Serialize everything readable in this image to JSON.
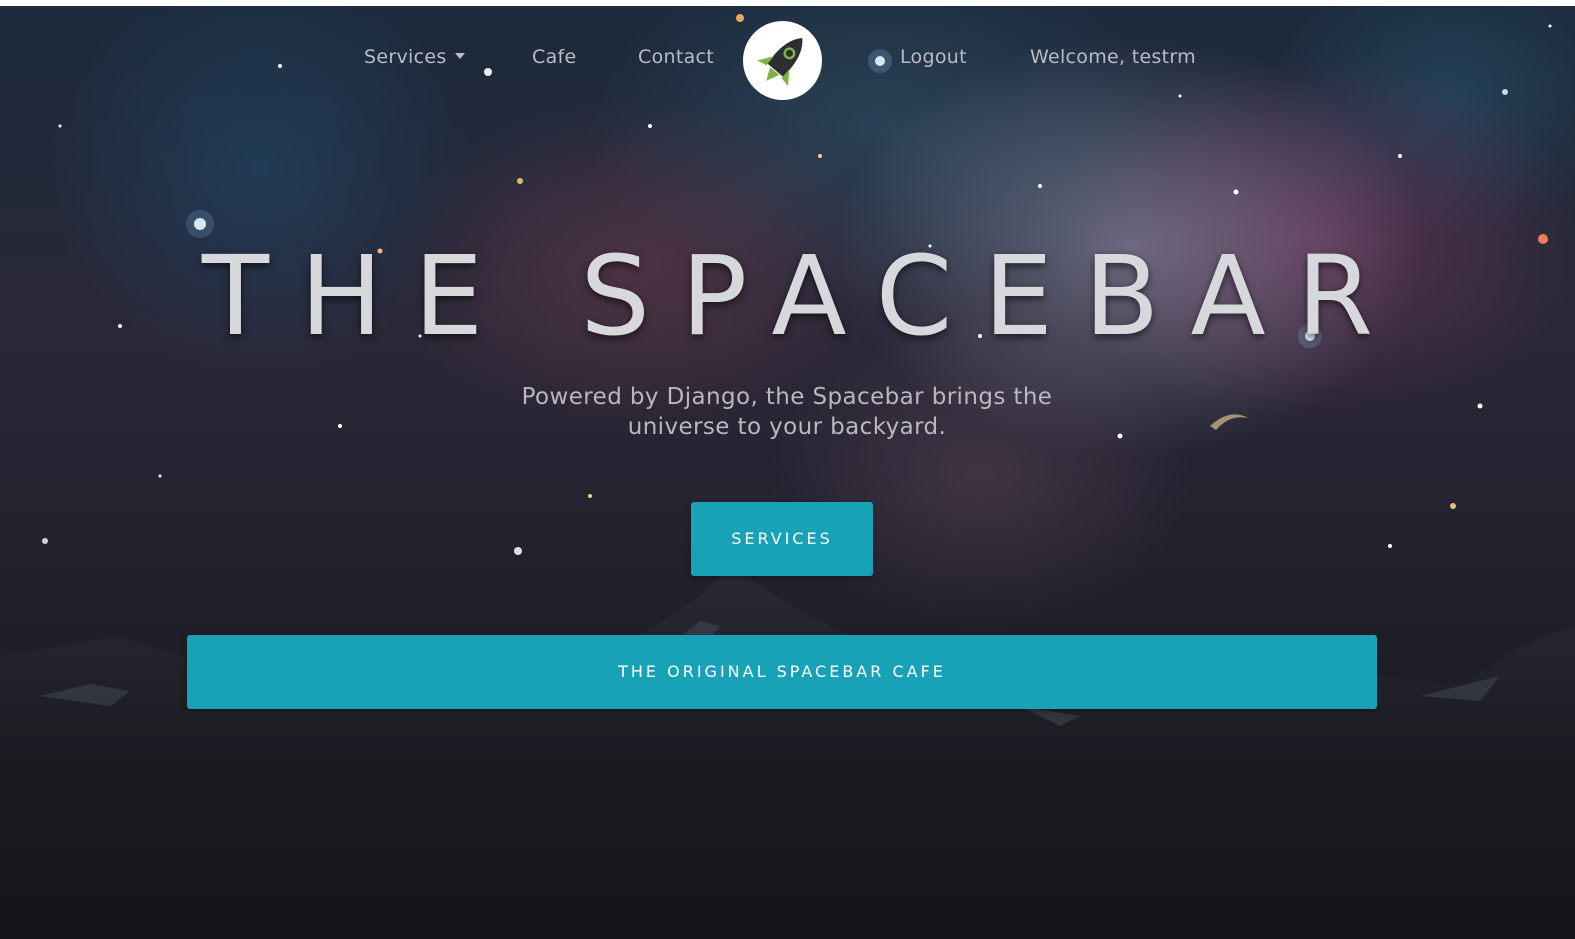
{
  "nav": {
    "services_label": "Services",
    "cafe_label": "Cafe",
    "contact_label": "Contact",
    "logout_label": "Logout",
    "welcome_label": "Welcome, testrm",
    "logo_icon": "rocket-icon"
  },
  "hero": {
    "title": "THE SPACEBAR",
    "subtitle_line1": "Powered by Django, the Spacebar brings the",
    "subtitle_line2": "universe to your backyard.",
    "services_button": "SERVICES",
    "cafe_button": "THE ORIGINAL SPACEBAR CAFE"
  },
  "colors": {
    "accent": "#17a2b8",
    "nav_text": "#b9bcc3",
    "logo_green": "#7cb342"
  }
}
